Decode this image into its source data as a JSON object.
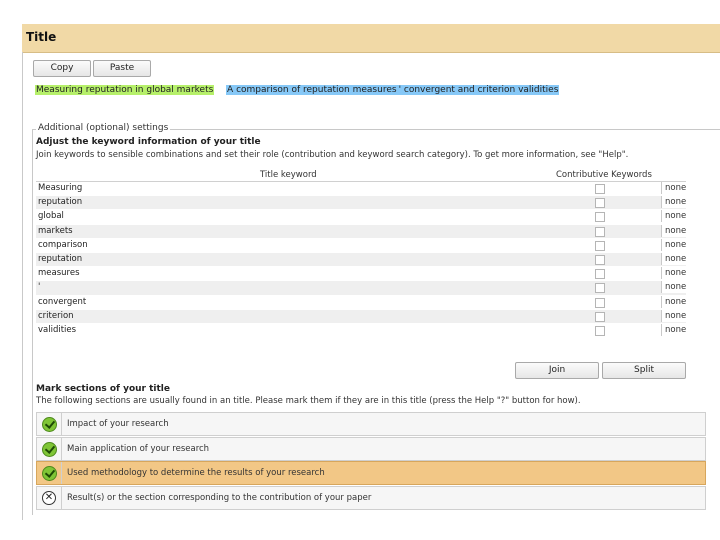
{
  "panel": {
    "title": "Title"
  },
  "toolbar": {
    "copy_label": "Copy",
    "paste_label": "Paste"
  },
  "title_text": {
    "part1": "Measuring reputation in global markets",
    "part2": "A comparison of reputation measures",
    "part3": "' convergent and criterion validities"
  },
  "settings": {
    "legend": "Additional (optional) settings",
    "heading": "Adjust the keyword information of your title",
    "description": "Join keywords to sensible combinations and set their role (contribution and keyword search category). To get more information, see \"Help\".",
    "columns": {
      "keyword": "Title keyword",
      "contributive": "Contributive Keywords"
    },
    "rows": [
      {
        "keyword": "Measuring",
        "role": "none",
        "checked": false
      },
      {
        "keyword": "reputation",
        "role": "none",
        "checked": false
      },
      {
        "keyword": "global",
        "role": "none",
        "checked": false
      },
      {
        "keyword": "markets",
        "role": "none",
        "checked": false
      },
      {
        "keyword": "comparison",
        "role": "none",
        "checked": false
      },
      {
        "keyword": "reputation",
        "role": "none",
        "checked": false
      },
      {
        "keyword": "measures",
        "role": "none",
        "checked": false
      },
      {
        "keyword": "'",
        "role": "none",
        "checked": false
      },
      {
        "keyword": "convergent",
        "role": "none",
        "checked": false
      },
      {
        "keyword": "criterion",
        "role": "none",
        "checked": false
      },
      {
        "keyword": "validities",
        "role": "none",
        "checked": false
      }
    ],
    "join_label": "Join",
    "split_label": "Split"
  },
  "sections": {
    "heading": "Mark sections of your title",
    "description": "The following sections are usually found in an title. Please mark them if they are in this title (press the Help \"?\" button for how).",
    "items": [
      {
        "label": "Impact of your research",
        "status": "marked",
        "icon": "check-icon",
        "active": false
      },
      {
        "label": "Main application of your research",
        "status": "marked",
        "icon": "check-icon",
        "active": false
      },
      {
        "label": "Used methodology to determine the results of your research",
        "status": "marked",
        "icon": "check-icon",
        "active": true
      },
      {
        "label": "Result(s) or the section corresponding to the contribution of your paper",
        "status": "unmarked",
        "icon": "cancel-icon",
        "active": false
      }
    ]
  },
  "colors": {
    "header_bg": "#f1d9a6",
    "active_section": "#f2c786",
    "highlight_green": "#b6f06a",
    "highlight_blue": "#86c8f7"
  }
}
